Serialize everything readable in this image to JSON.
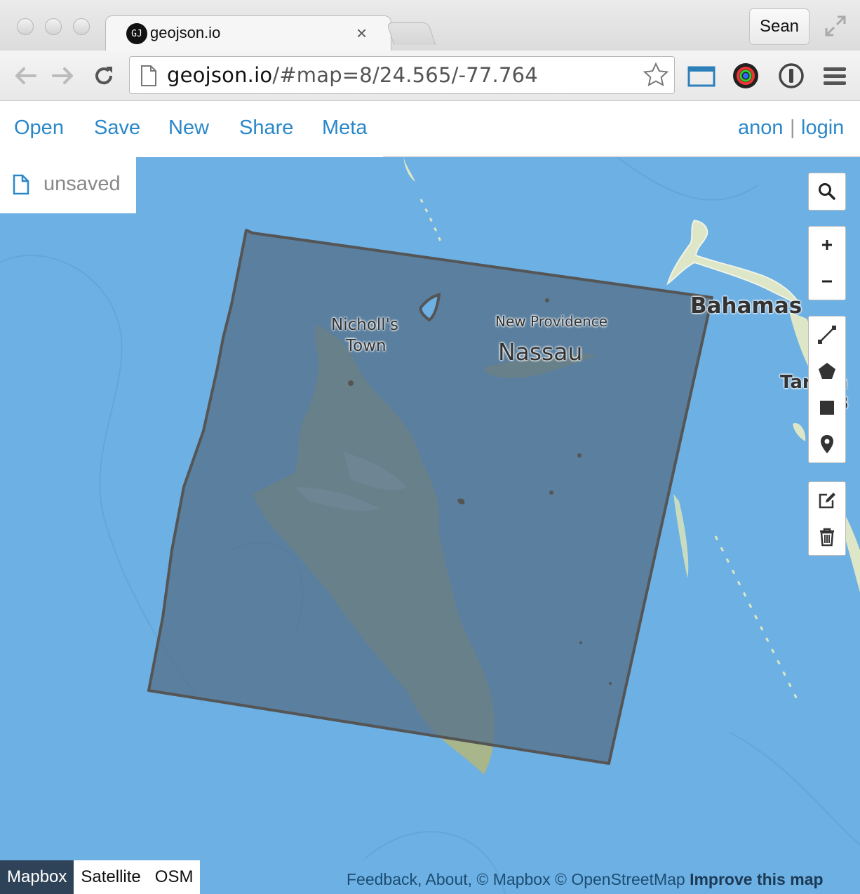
{
  "browser": {
    "tab_title": "geojson.io",
    "tab_favicon": "GJ",
    "tab_close": "×",
    "profile": "Sean",
    "url_host": "geojson.io",
    "url_path": "/#map=8/24.565/-77.764",
    "icons": [
      "back-icon",
      "forward-icon",
      "reload-icon",
      "page-icon",
      "bookmark-star-icon",
      "cast-icon",
      "color-picker-icon",
      "password-manager-icon",
      "menu-icon",
      "fullscreen-icon"
    ]
  },
  "app": {
    "menu": [
      "Open",
      "Save",
      "New",
      "Share",
      "Meta"
    ],
    "auth": {
      "user": "anon",
      "separator": "|",
      "login": "login"
    },
    "file_status": "unsaved"
  },
  "map": {
    "labels": {
      "nicholls_line1": "Nicholl's",
      "nicholls_line2": "Town",
      "new_providence": "New Providence",
      "nassau": "Nassau",
      "bahamas": "Bahamas",
      "tarpum_partial_1": "Tar",
      "tarpum_partial_2": "n B"
    },
    "controls": [
      "search-icon",
      "zoom-in-icon",
      "zoom-out-icon",
      "draw-line-icon",
      "draw-polygon-icon",
      "draw-rectangle-icon",
      "draw-marker-icon",
      "edit-icon",
      "delete-icon"
    ],
    "colors": {
      "water": "#6cb0e4",
      "polygon_fill": "#667f95",
      "polygon_stroke": "#555555",
      "land": "#a9b58a"
    }
  },
  "layers": {
    "items": [
      "Mapbox",
      "Satellite",
      "OSM"
    ],
    "active": "Mapbox"
  },
  "attribution": {
    "feedback": "Feedback",
    "about": "About",
    "mapbox": "© Mapbox",
    "osm": "© OpenStreetMap",
    "improve": "Improve this map",
    "comma": ","
  }
}
